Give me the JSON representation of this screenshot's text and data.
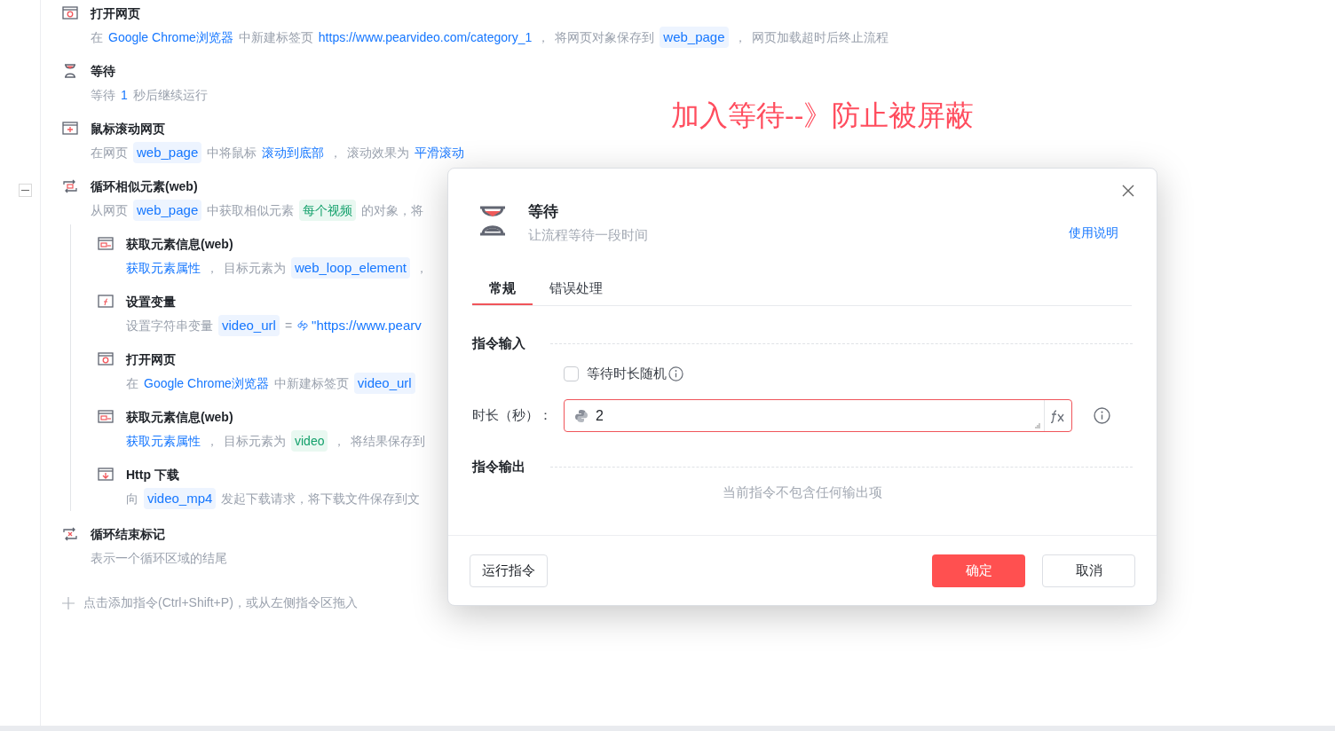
{
  "steps": [
    {
      "kind": "open-page",
      "title": "打开网页",
      "segments": [
        {
          "kind": "text",
          "text": "在"
        },
        {
          "kind": "link",
          "text": "Google Chrome浏览器"
        },
        {
          "kind": "text",
          "text": "中新建标签页"
        },
        {
          "kind": "link",
          "text": "https://www.pearvideo.com/category_1"
        },
        {
          "kind": "text",
          "text": "，"
        },
        {
          "kind": "text",
          "text": "将网页对象保存到"
        },
        {
          "kind": "var",
          "text": "web_page"
        },
        {
          "kind": "text",
          "text": "，"
        },
        {
          "kind": "text",
          "text": "网页加载超时后终止流程"
        }
      ]
    },
    {
      "kind": "wait",
      "title": "等待",
      "segments": [
        {
          "kind": "text",
          "text": "等待"
        },
        {
          "kind": "link",
          "text": "1"
        },
        {
          "kind": "text",
          "text": "秒后继续运行"
        }
      ]
    },
    {
      "kind": "scroll",
      "title": "鼠标滚动网页",
      "segments": [
        {
          "kind": "text",
          "text": "在网页"
        },
        {
          "kind": "var",
          "text": "web_page"
        },
        {
          "kind": "text",
          "text": "中将鼠标"
        },
        {
          "kind": "link",
          "text": "滚动到底部"
        },
        {
          "kind": "text",
          "text": "，"
        },
        {
          "kind": "text",
          "text": "滚动效果为"
        },
        {
          "kind": "link",
          "text": "平滑滚动"
        }
      ]
    },
    {
      "kind": "loop",
      "title": "循环相似元素(web)",
      "expanded": true,
      "segments": [
        {
          "kind": "text",
          "text": "从网页"
        },
        {
          "kind": "var",
          "text": "web_page"
        },
        {
          "kind": "text",
          "text": "中获取相似元素"
        },
        {
          "kind": "tag",
          "text": "每个视频"
        },
        {
          "kind": "text",
          "text": "的对象，将"
        }
      ],
      "children": [
        {
          "kind": "get-info",
          "title": "获取元素信息(web)",
          "segments": [
            {
              "kind": "link",
              "text": "获取元素属性"
            },
            {
              "kind": "text",
              "text": "，"
            },
            {
              "kind": "text",
              "text": "目标元素为"
            },
            {
              "kind": "var",
              "text": "web_loop_element"
            },
            {
              "kind": "text",
              "text": "，"
            }
          ]
        },
        {
          "kind": "set-var",
          "title": "设置变量",
          "segments": [
            {
              "kind": "text",
              "text": "设置字符串变量"
            },
            {
              "kind": "var",
              "text": "video_url"
            },
            {
              "kind": "text",
              "text": "="
            },
            {
              "kind": "code",
              "text": "\"https://www.pearv"
            }
          ]
        },
        {
          "kind": "open-page",
          "title": "打开网页",
          "segments": [
            {
              "kind": "text",
              "text": "在"
            },
            {
              "kind": "link",
              "text": "Google Chrome浏览器"
            },
            {
              "kind": "text",
              "text": "中新建标签页"
            },
            {
              "kind": "var",
              "text": "video_url"
            }
          ]
        },
        {
          "kind": "get-info",
          "title": "获取元素信息(web)",
          "segments": [
            {
              "kind": "link",
              "text": "获取元素属性"
            },
            {
              "kind": "text",
              "text": "，"
            },
            {
              "kind": "text",
              "text": "目标元素为"
            },
            {
              "kind": "tag",
              "text": "video"
            },
            {
              "kind": "text",
              "text": "，"
            },
            {
              "kind": "text",
              "text": "将结果保存到"
            }
          ]
        },
        {
          "kind": "download",
          "title": "Http 下载",
          "segments": [
            {
              "kind": "text",
              "text": "向"
            },
            {
              "kind": "var",
              "text": "video_mp4"
            },
            {
              "kind": "text",
              "text": "发起下载请求，将下载文件保存到文"
            }
          ]
        }
      ]
    },
    {
      "kind": "loop-end",
      "title": "循环结束标记",
      "segments": [
        {
          "kind": "text",
          "text": "表示一个循环区域的结尾"
        }
      ]
    }
  ],
  "add_hint": "点击添加指令(Ctrl+Shift+P)，或从左侧指令区拖入",
  "annotation": "加入等待--》防止被屏蔽",
  "dialog": {
    "title": "等待",
    "subtitle": "让流程等待一段时间",
    "help_link": "使用说明",
    "tabs": [
      {
        "label": "常规",
        "selected": true
      },
      {
        "label": "错误处理",
        "selected": false
      }
    ],
    "input_heading": "指令输入",
    "checkbox": {
      "label": "等待时长随机",
      "checked": false
    },
    "field": {
      "label": "时长（秒）：",
      "value": "2",
      "error": true
    },
    "output_heading": "指令输出",
    "output_empty": "当前指令不包含任何输出项",
    "buttons": {
      "run": "运行指令",
      "ok": "确定",
      "cancel": "取消"
    }
  }
}
